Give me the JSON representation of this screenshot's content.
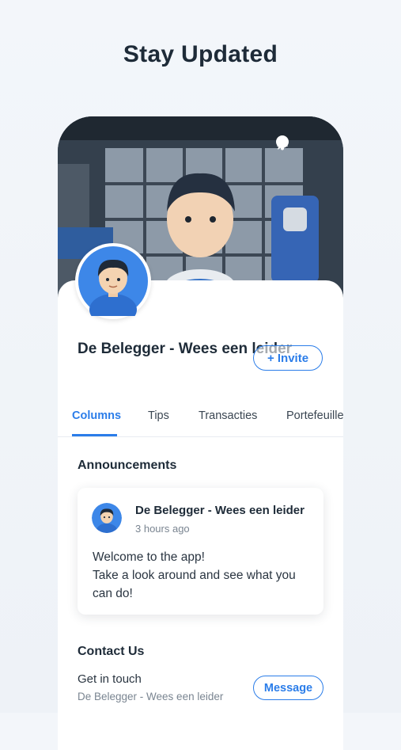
{
  "headline": "Stay Updated",
  "header_icons": [
    "chat-icon",
    "bell-icon"
  ],
  "profile": {
    "name": "De Belegger - Wees een leider",
    "invite_label": "+ Invite"
  },
  "tabs": [
    {
      "label": "Columns",
      "active": true
    },
    {
      "label": "Tips",
      "active": false
    },
    {
      "label": "Transacties",
      "active": false
    },
    {
      "label": "Portefeuille",
      "active": false
    }
  ],
  "announcements": {
    "title": "Announcements",
    "post": {
      "author": "De Belegger - Wees een leider",
      "time": "3 hours ago",
      "lines": [
        "Welcome to the app!",
        "Take a look around and see what you",
        "can do!"
      ]
    }
  },
  "contact": {
    "title": "Contact Us",
    "line": "Get in touch",
    "sub": "De Belegger - Wees een leider",
    "button_label": "Message"
  },
  "colors": {
    "accent": "#2b7de9",
    "title": "#1e2b38"
  }
}
